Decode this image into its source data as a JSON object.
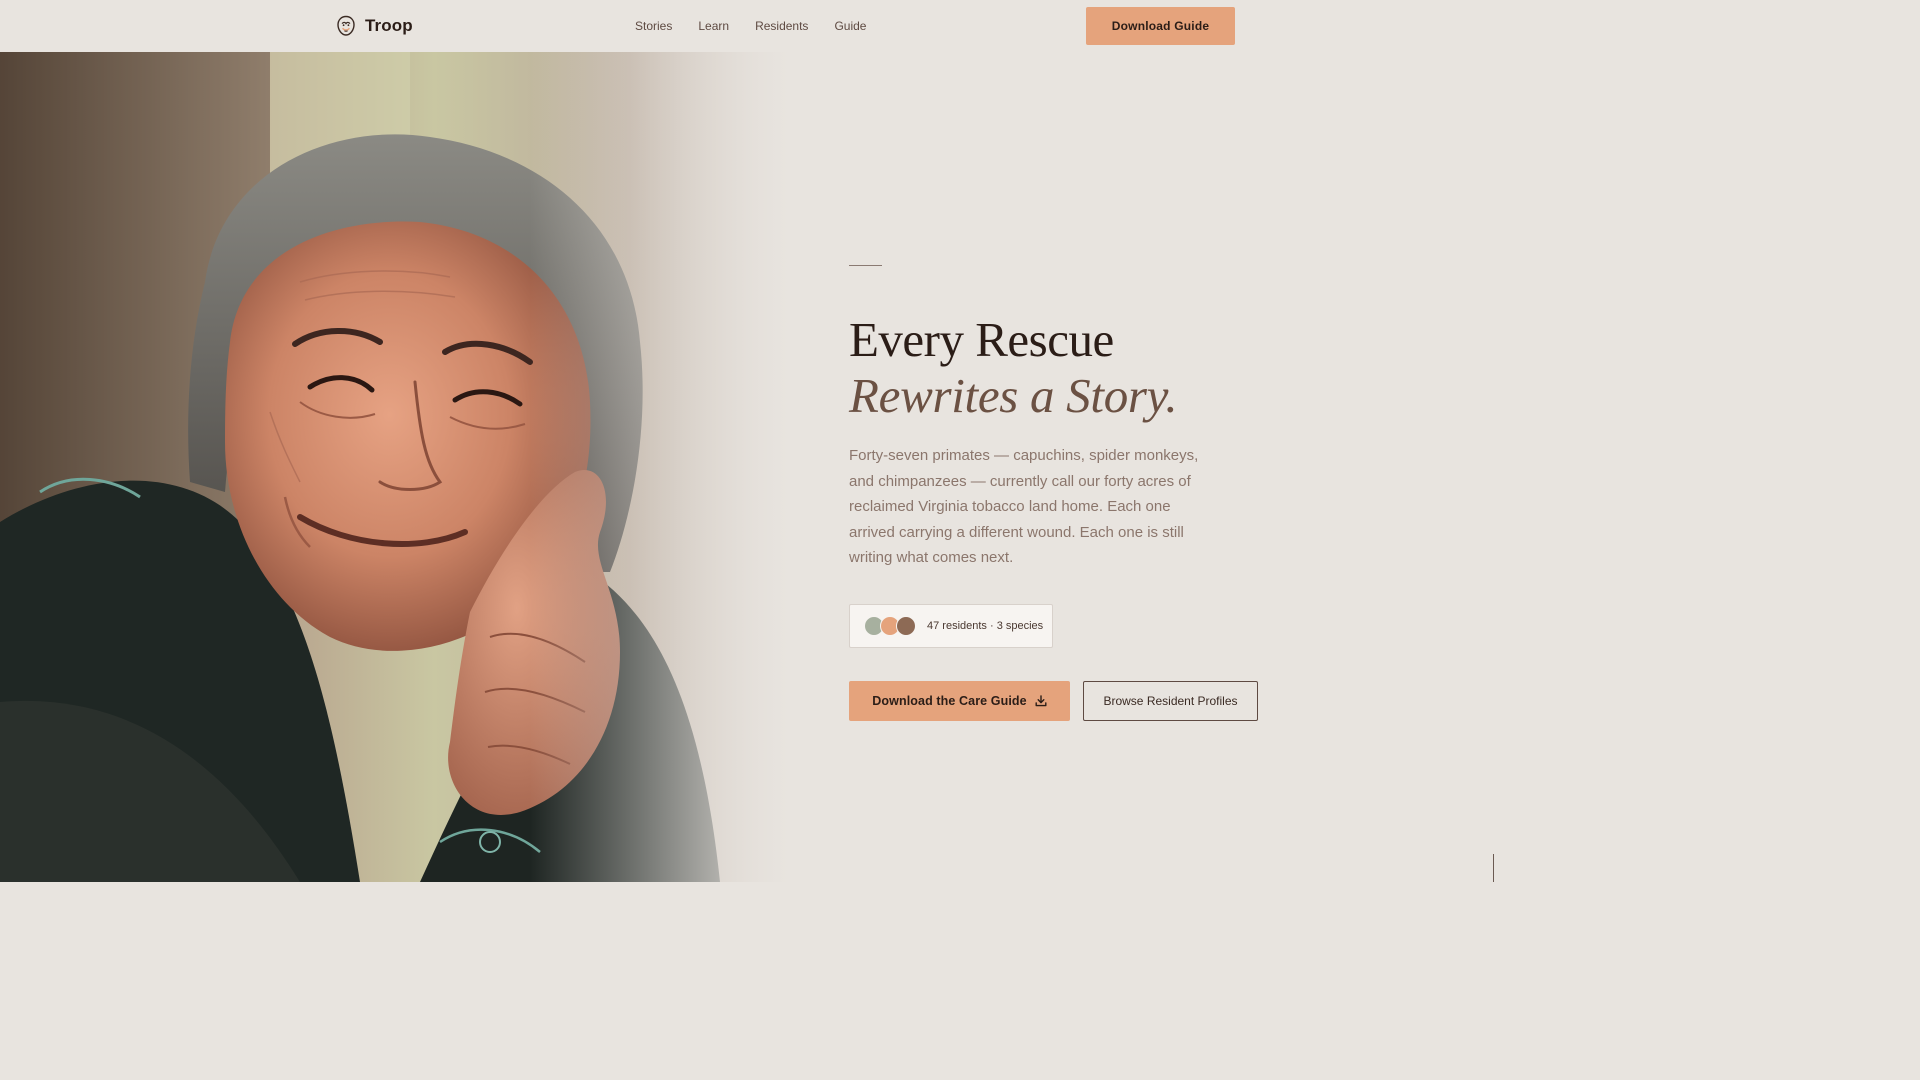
{
  "nav": {
    "brand": "Troop",
    "links": [
      "Stories",
      "Learn",
      "Residents",
      "Guide"
    ],
    "cta": "Download Guide"
  },
  "hero": {
    "title_line1": "Every Rescue",
    "title_line2": "Rewrites a Story.",
    "lede": "Forty-seven primates — capuchins, spider monkeys, and chimpanzees — currently call our forty acres of reclaimed Virginia tobacco land home. Each one arrived carrying a different wound. Each one is still writing what comes next.",
    "stat": "47 residents · 3 species",
    "avatar_colors": [
      "#a7b09f",
      "#e5a37c",
      "#8d6a55"
    ],
    "primary_cta": "Download the Care Guide",
    "secondary_cta": "Browse Resident Profiles"
  },
  "colors": {
    "background": "#e8e4df",
    "accent": "#e5a37c",
    "text_dark": "#2b1d17",
    "text_muted": "#8b766c",
    "italic": "#6b5143"
  },
  "icons": {
    "brand": "monkey-face-icon",
    "download": "download-icon"
  }
}
